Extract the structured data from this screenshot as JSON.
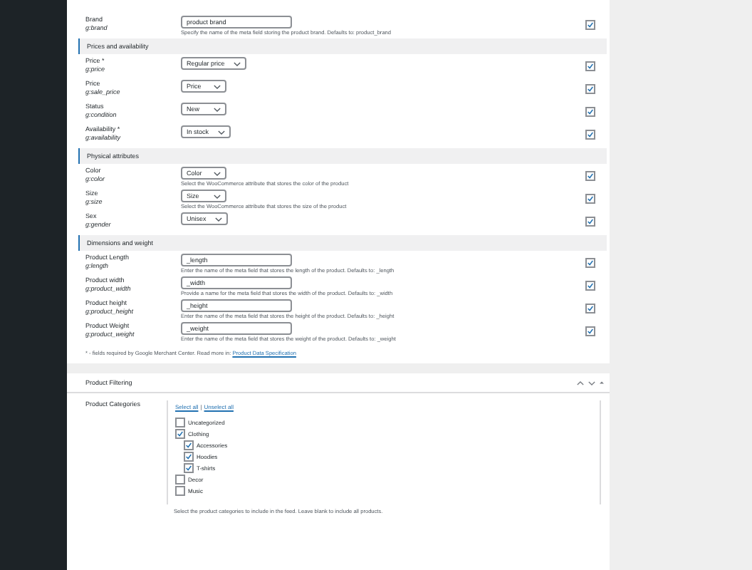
{
  "attribute_sections": [
    {
      "rows": [
        {
          "label": "Brand",
          "tag": "g:brand",
          "kind": "text",
          "value": "product brand",
          "description": "Specify the name of the meta field storing the product brand. Defaults to: product_brand",
          "checked": true
        }
      ]
    },
    {
      "title": "Prices and availability",
      "rows": [
        {
          "label": "Price *",
          "tag": "g:price",
          "kind": "select",
          "value": "Regular price",
          "checked": true
        },
        {
          "label": "Price",
          "tag": "g:sale_price",
          "kind": "select",
          "value": "Price",
          "checked": true
        },
        {
          "label": "Status",
          "tag": "g:condition",
          "kind": "select",
          "value": "New",
          "checked": true
        },
        {
          "label": "Availability *",
          "tag": "g:availability",
          "kind": "select",
          "value": "In stock",
          "checked": true
        }
      ]
    },
    {
      "title": "Physical attributes",
      "rows": [
        {
          "label": "Color",
          "tag": "g:color",
          "kind": "select",
          "value": "Color",
          "description": "Select the WooCommerce attribute that stores the color of the product",
          "checked": true
        },
        {
          "label": "Size",
          "tag": "g:size",
          "kind": "select",
          "value": "Size",
          "description": "Select the WooCommerce attribute that stores the size of the product",
          "checked": true
        },
        {
          "label": "Sex",
          "tag": "g:gender",
          "kind": "select",
          "value": "Unisex",
          "checked": true
        }
      ]
    },
    {
      "title": "Dimensions and weight",
      "rows": [
        {
          "label": "Product Length",
          "tag": "g:length",
          "kind": "text",
          "value": "_length",
          "description": "Enter the name of the meta field that stores the length of the product. Defaults to: _length",
          "checked": true
        },
        {
          "label": "Product width",
          "tag": "g:product_width",
          "kind": "text",
          "value": "_width",
          "description": "Provide a name for the meta field that stores the width of the product. Defaults to: _width",
          "checked": true
        },
        {
          "label": "Product height",
          "tag": "g:product_height",
          "kind": "text",
          "value": "_height",
          "description": "Enter the name of the meta field that stores the height of the product. Defaults to: _height",
          "checked": true
        },
        {
          "label": "Product Weight",
          "tag": "g:product_weight",
          "kind": "text",
          "value": "_weight",
          "description": "Enter the name of the meta field that stores the weight of the product. Defaults to: _weight",
          "checked": true
        }
      ]
    }
  ],
  "footnote": {
    "text": "* - fields required by Google Merchant Center. Read more in:",
    "link": "Product Data Specification"
  },
  "filtering": {
    "title": "Product Filtering",
    "label": "Product Categories",
    "select_all": "Select all",
    "separator": "|",
    "unselect_all": "Unselect all",
    "categories": [
      {
        "name": "Uncategorized",
        "checked": false
      },
      {
        "name": "Clothing",
        "checked": true,
        "children": [
          {
            "name": "Accessories",
            "checked": true
          },
          {
            "name": "Hoodies",
            "checked": true
          },
          {
            "name": "T-shirts",
            "checked": true
          }
        ]
      },
      {
        "name": "Decor",
        "checked": false
      },
      {
        "name": "Music",
        "checked": false
      }
    ],
    "description": "Select the product categories to include in the feed. Leave blank to include all products."
  }
}
